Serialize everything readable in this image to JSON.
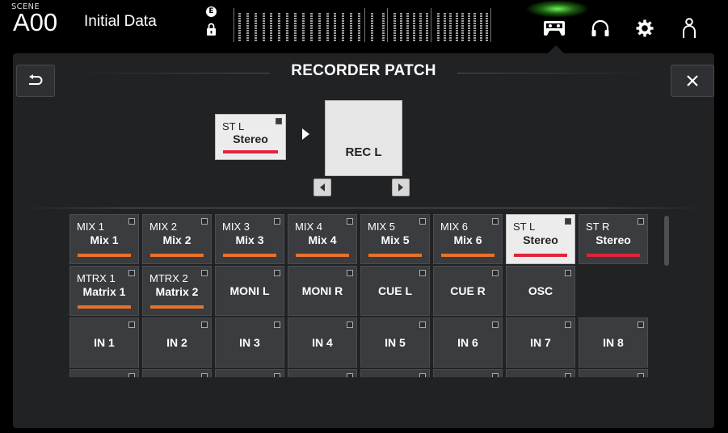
{
  "topbar": {
    "scene_label": "SCENE",
    "scene_number": "A00",
    "scene_title": "Initial Data",
    "edit_badge": "E",
    "icons": [
      "lock-icon",
      "recorder-icon",
      "headphones-icon",
      "gear-icon",
      "user-icon"
    ],
    "accent_glow": "#7dff5a"
  },
  "panel": {
    "title": "RECORDER PATCH",
    "back_icon": "back-icon",
    "close_icon": "close-icon"
  },
  "patch": {
    "source": {
      "id": "ST L",
      "name": "Stereo",
      "bar_color": "#e0233b"
    },
    "destination": {
      "label": "REC L"
    }
  },
  "grid": {
    "rows": [
      [
        {
          "id": "MIX 1",
          "name": "Mix 1",
          "bar_color": "#e8722a"
        },
        {
          "id": "MIX 2",
          "name": "Mix 2",
          "bar_color": "#e8722a"
        },
        {
          "id": "MIX 3",
          "name": "Mix 3",
          "bar_color": "#e8722a"
        },
        {
          "id": "MIX 4",
          "name": "Mix 4",
          "bar_color": "#e8722a"
        },
        {
          "id": "MIX 5",
          "name": "Mix 5",
          "bar_color": "#e8722a"
        },
        {
          "id": "MIX 6",
          "name": "Mix 6",
          "bar_color": "#e8722a"
        },
        {
          "id": "ST L",
          "name": "Stereo",
          "bar_color": "#e0233b",
          "selected": true
        },
        {
          "id": "ST R",
          "name": "Stereo",
          "bar_color": "#e0233b"
        }
      ],
      [
        {
          "id": "MTRX 1",
          "name": "Matrix 1",
          "bar_color": "#e8722a"
        },
        {
          "id": "MTRX 2",
          "name": "Matrix 2",
          "bar_color": "#e8722a"
        },
        {
          "id": "",
          "name": "MONI L"
        },
        {
          "id": "",
          "name": "MONI R"
        },
        {
          "id": "",
          "name": "CUE L"
        },
        {
          "id": "",
          "name": "CUE R"
        },
        {
          "id": "",
          "name": "OSC"
        }
      ],
      [
        {
          "id": "",
          "name": "IN 1"
        },
        {
          "id": "",
          "name": "IN 2"
        },
        {
          "id": "",
          "name": "IN 3"
        },
        {
          "id": "",
          "name": "IN 4"
        },
        {
          "id": "",
          "name": "IN 5"
        },
        {
          "id": "",
          "name": "IN 6"
        },
        {
          "id": "",
          "name": "IN 7"
        },
        {
          "id": "",
          "name": "IN 8"
        }
      ],
      [
        {
          "id": "",
          "name": ""
        },
        {
          "id": "",
          "name": ""
        },
        {
          "id": "",
          "name": ""
        },
        {
          "id": "",
          "name": ""
        },
        {
          "id": "",
          "name": ""
        },
        {
          "id": "",
          "name": ""
        },
        {
          "id": "",
          "name": ""
        },
        {
          "id": "",
          "name": ""
        }
      ]
    ]
  }
}
